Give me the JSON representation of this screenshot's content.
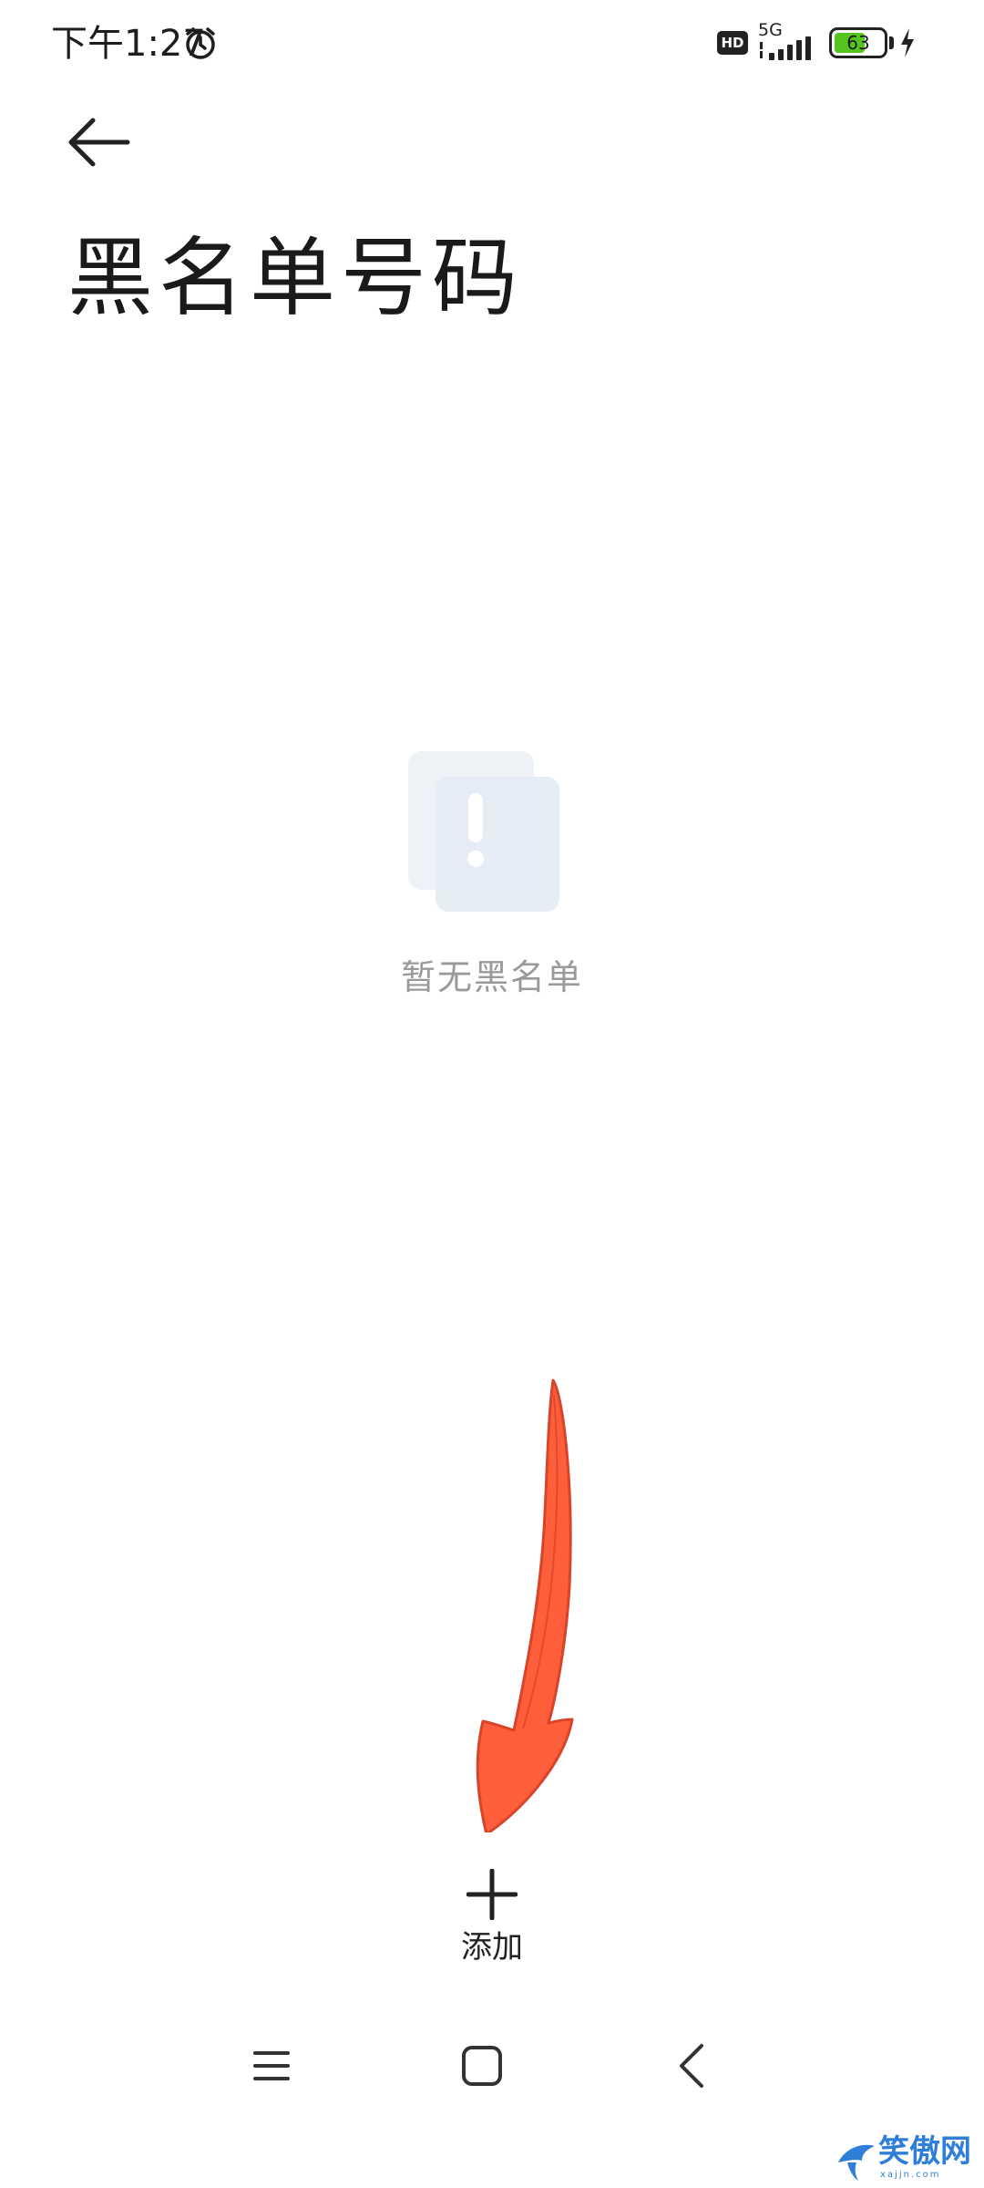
{
  "status_bar": {
    "time": "下午1:27",
    "hd_label": "HD",
    "network_label": "5G",
    "battery_level": "63",
    "battery_fill_percent": 63,
    "charging": true
  },
  "header": {
    "title": "黑名单号码"
  },
  "empty_state": {
    "message": "暂无黑名单"
  },
  "actions": {
    "add_label": "添加"
  },
  "colors": {
    "arrow": "#ff5e3a",
    "battery_fill": "#54c41f",
    "illustration": "#e3ebf4"
  },
  "watermark": {
    "text": "笑傲网",
    "sub": "xajjn.com"
  }
}
